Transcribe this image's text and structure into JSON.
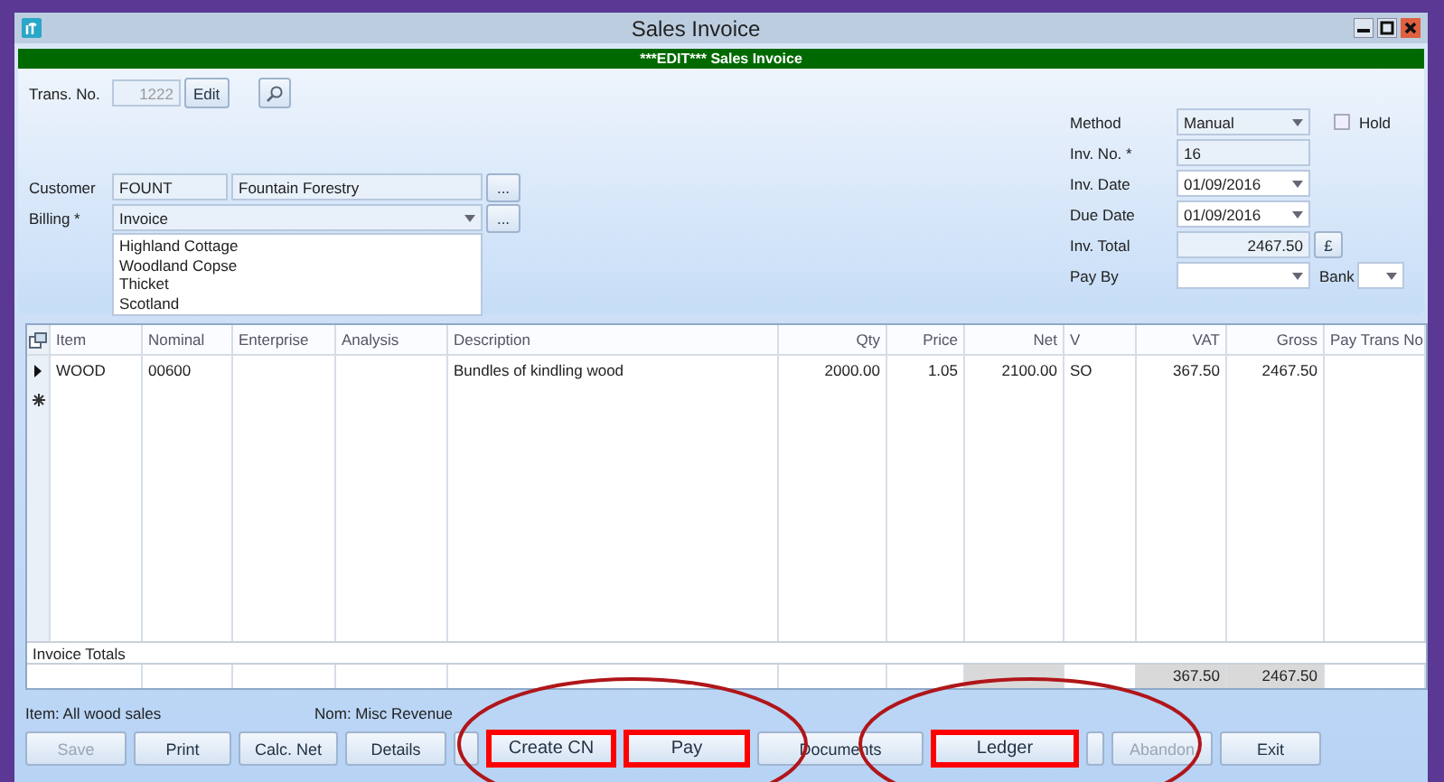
{
  "window": {
    "title": "Sales Invoice"
  },
  "header_bar": {
    "text": "***EDIT*** Sales Invoice"
  },
  "form": {
    "trans_no": {
      "label": "Trans. No.",
      "value": "1222",
      "disabled": true,
      "edit_button": "Edit"
    },
    "customer": {
      "label": "Customer",
      "code": "FOUNT",
      "name": "Fountain Forestry",
      "browse_button": "..."
    },
    "billing": {
      "label": "Billing *",
      "value": "Invoice",
      "browse_button": "...",
      "address_lines": [
        "Highland Cottage",
        "Woodland Copse",
        "Thicket",
        "Scotland"
      ]
    },
    "method": {
      "label": "Method",
      "value": "Manual"
    },
    "hold": {
      "label": "Hold",
      "checked": false
    },
    "inv_no": {
      "label": "Inv. No. *",
      "value": "16"
    },
    "inv_date": {
      "label": "Inv. Date",
      "value": "01/09/2016"
    },
    "due_date": {
      "label": "Due Date",
      "value": "01/09/2016"
    },
    "inv_total": {
      "label": "Inv. Total",
      "value": "2467.50",
      "currency_button": "£"
    },
    "pay_by": {
      "label": "Pay By"
    },
    "bank": {
      "label": "Bank"
    }
  },
  "table": {
    "columns": [
      "Item",
      "Nominal",
      "Enterprise",
      "Analysis",
      "Description",
      "Qty",
      "Price",
      "Net",
      "V",
      "VAT",
      "Gross",
      "Pay Trans No"
    ],
    "rows": [
      {
        "current": true,
        "cells": [
          "WOOD",
          "00600",
          "",
          "",
          "Bundles of kindling wood",
          "2000.00",
          "1.05",
          "2100.00",
          "SO",
          "367.50",
          "2467.50",
          ""
        ]
      }
    ],
    "totals": {
      "label": "Invoice Totals",
      "vat": "367.50",
      "gross": "2467.50"
    }
  },
  "status": {
    "item": "Item: All wood sales",
    "nominal": "Nom: Misc Revenue"
  },
  "buttons": [
    {
      "kind": "button",
      "label": "Save",
      "disabled": true,
      "highlighted": false
    },
    {
      "kind": "button",
      "label": "Print",
      "disabled": false,
      "highlighted": false
    },
    {
      "kind": "button",
      "label": "Calc. Net",
      "disabled": false,
      "highlighted": false
    },
    {
      "kind": "button",
      "label": "Details",
      "disabled": false,
      "highlighted": false
    },
    {
      "kind": "stub",
      "highlighted": false
    },
    {
      "kind": "button",
      "label": "Create CN",
      "disabled": false,
      "highlighted": true
    },
    {
      "kind": "button",
      "label": "Pay",
      "disabled": false,
      "highlighted": true
    },
    {
      "kind": "button",
      "label": "Documents",
      "disabled": false,
      "highlighted": false
    },
    {
      "kind": "button",
      "label": "Ledger",
      "disabled": false,
      "highlighted": true
    },
    {
      "kind": "stub",
      "highlighted": false
    },
    {
      "kind": "button",
      "label": "Abandon",
      "disabled": true,
      "highlighted": false
    },
    {
      "kind": "button",
      "label": "Exit",
      "disabled": false,
      "highlighted": false
    }
  ],
  "annotations": [
    {
      "kind": "ellipse"
    },
    {
      "kind": "ellipse"
    }
  ]
}
